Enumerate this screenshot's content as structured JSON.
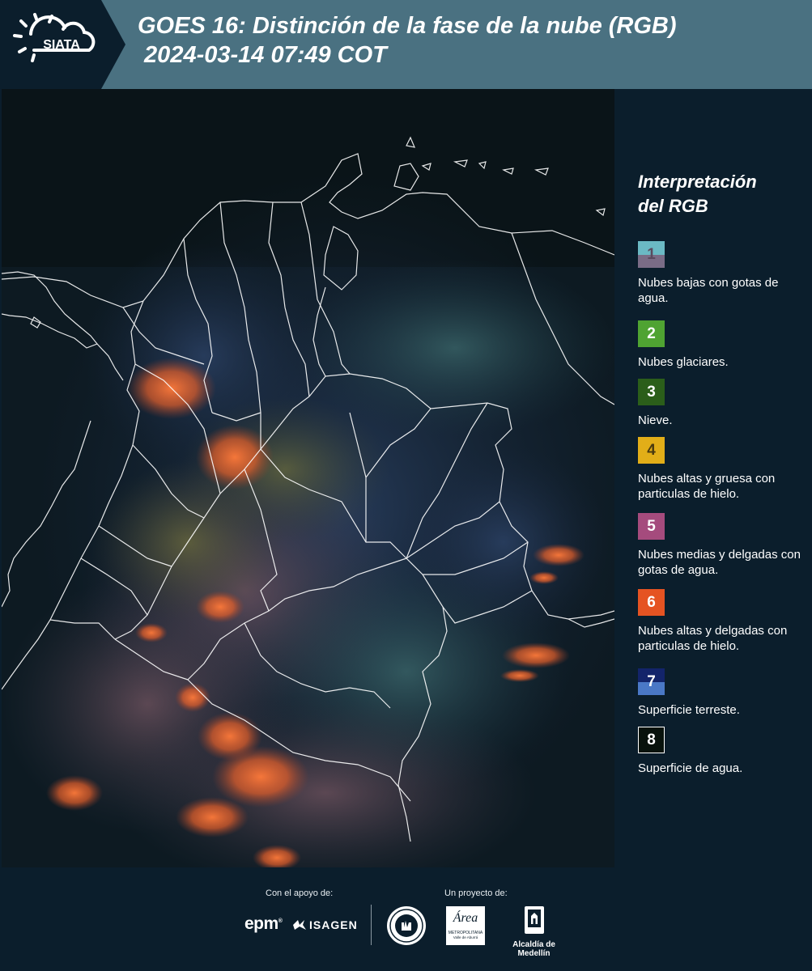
{
  "header": {
    "logo_text": "SIATA",
    "title_line1": "GOES 16: Distinción de la fase de la nube (RGB)",
    "title_line2": " 2024-03-14 07:49 COT"
  },
  "legend": {
    "title_line1": "Interpretación",
    "title_line2": "del RGB",
    "items": [
      {
        "number": "1",
        "label": "Nubes bajas con gotas de agua.",
        "color_top": "#6bb9c4",
        "color_bottom": "#7a6c86"
      },
      {
        "number": "2",
        "label": "Nubes glaciares.",
        "color": "#4fa332"
      },
      {
        "number": "3",
        "label": "Nieve.",
        "color": "#2b5e1a"
      },
      {
        "number": "4",
        "label": "Nubes altas y gruesa con particulas de hielo.",
        "color": "#e2ae18"
      },
      {
        "number": "5",
        "label": "Nubes medias y delgadas con gotas de agua.",
        "color": "#a54b7d"
      },
      {
        "number": "6",
        "label": "Nubes altas y delgadas con particulas de hielo.",
        "color": "#e55322"
      },
      {
        "number": "7",
        "label": "Superficie terreste.",
        "color_top": "#13246a",
        "color_bottom": "#4a78c6"
      },
      {
        "number": "8",
        "label": "Superficie de agua.",
        "color": "#08120c"
      }
    ]
  },
  "footer": {
    "support_label": "Con el apoyo de:",
    "project_label": "Un proyecto de:",
    "epm_logo": "epm",
    "isagen_logo": "ISAGEN",
    "metropolitana_logo_line1": "Área",
    "metropolitana_logo_line2": "METROPOLITANA",
    "metropolitana_logo_line3": "Valle de Aburrá",
    "alcaldia_label": "Alcaldía de Medellín"
  }
}
